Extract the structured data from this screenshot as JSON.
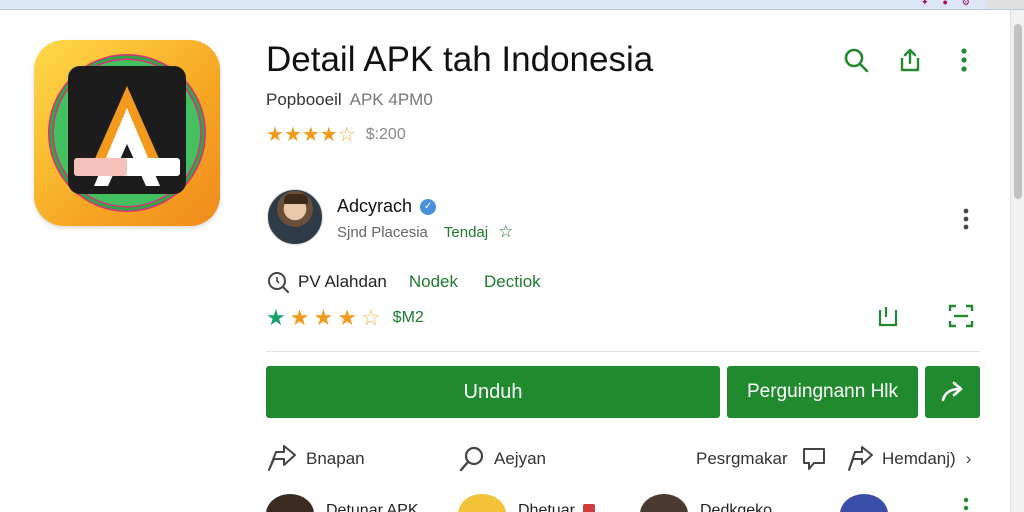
{
  "window": {
    "title_left": "",
    "title_center": "",
    "tray_icons": [
      "puzzle-icon",
      "shield-icon",
      "settings-icon"
    ]
  },
  "app": {
    "title": "Detail APK  tah Indonesia",
    "publisher": "Popbooeil",
    "publisher_meta": "APK  4PM0",
    "rating_stars": 4.5,
    "rating_count": "$:200"
  },
  "top_actions": [
    "search-icon",
    "share-icon",
    "more-vert-icon"
  ],
  "developer": {
    "name": "Adcyrach",
    "subtitle": "Sjnd Placesia",
    "trend_label": "Tendaj"
  },
  "info": {
    "label": "PV  Alahdan",
    "link1": "Nodek",
    "link2": "Dectiok"
  },
  "rating2": {
    "stars": 4.5,
    "count": "$M2"
  },
  "buttons": {
    "download": "Unduh",
    "secondary": "Perguingnann Hlk",
    "share_icon": "arrow-forward-icon"
  },
  "bottom_actions": {
    "item1": "Bnapan",
    "item2": "Aejyan",
    "item3": "Pesrgmakar",
    "item4": "Hemdanj)"
  },
  "related": [
    {
      "label": "Detunar APK"
    },
    {
      "label": "Dhetuar"
    },
    {
      "label": "Dedkgeko"
    }
  ],
  "colors": {
    "accent_green": "#218a2e",
    "star_orange": "#f29a1d",
    "star_green": "#15a36a",
    "link_green": "#1f7a2e"
  }
}
